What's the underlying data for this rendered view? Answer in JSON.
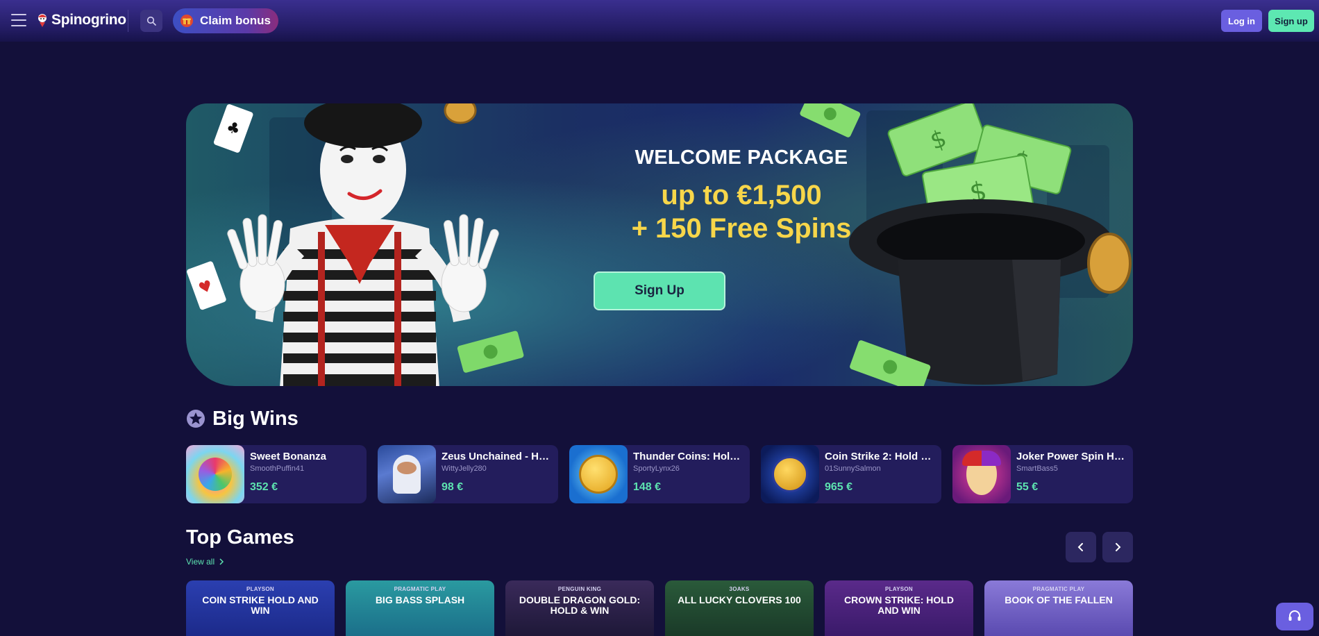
{
  "header": {
    "logo_text": "Spinogrino",
    "claim_bonus_label": "Claim bonus",
    "login_label": "Log in",
    "signup_label": "Sign up"
  },
  "hero": {
    "kicker": "WELCOME PACKAGE",
    "amount": "up to €1,500",
    "spins": "+ 150 Free Spins",
    "cta_label": "Sign Up"
  },
  "big_wins": {
    "title": "Big Wins",
    "items": [
      {
        "game": "Sweet Bonanza",
        "user": "SmoothPuffin41",
        "amount": "352 €"
      },
      {
        "game": "Zeus Unchained - Hol...",
        "user": "WittyJelly280",
        "amount": "98 €"
      },
      {
        "game": "Thunder Coins: Hold ...",
        "user": "SportyLynx26",
        "amount": "148 €"
      },
      {
        "game": "Coin Strike 2: Hold an...",
        "user": "01SunnySalmon",
        "amount": "965 €"
      },
      {
        "game": "Joker Power Spin Hol...",
        "user": "SmartBass5",
        "amount": "55 €"
      }
    ]
  },
  "top_games": {
    "title": "Top Games",
    "view_all": "View all",
    "items": [
      {
        "provider": "PLAYSON",
        "name": "COIN STRIKE HOLD AND WIN"
      },
      {
        "provider": "PRAGMATIC PLAY",
        "name": "BIG BASS SPLASH"
      },
      {
        "provider": "PENGUIN KING",
        "name": "DOUBLE DRAGON GOLD: HOLD & WIN"
      },
      {
        "provider": "3OAKS",
        "name": "ALL LUCKY CLOVERS 100"
      },
      {
        "provider": "PLAYSON",
        "name": "CROWN STRIKE: HOLD AND WIN"
      },
      {
        "provider": "PRAGMATIC PLAY",
        "name": "BOOK OF THE FALLEN"
      }
    ]
  },
  "colors": {
    "page_bg": "#13103a",
    "accent_green": "#5de3b0",
    "accent_purple": "#6a5fe0",
    "gold": "#f7d64a",
    "card_bg": "#231d5c"
  },
  "icons": {
    "menu": "hamburger-icon",
    "search": "search-icon",
    "bonus": "gift-icon",
    "big_wins": "star-badge-icon",
    "prev": "chevron-left-icon",
    "next": "chevron-right-icon",
    "support": "headset-icon"
  }
}
